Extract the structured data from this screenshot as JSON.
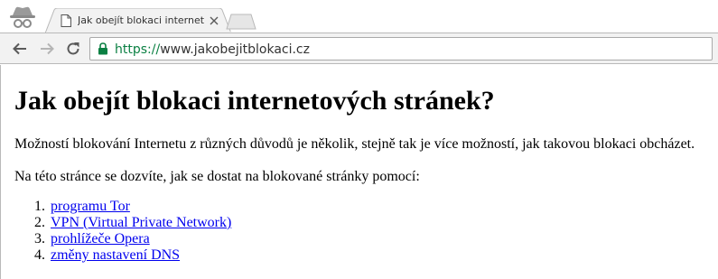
{
  "tab": {
    "title": "Jak obejít blokaci internetových stránek"
  },
  "address_bar": {
    "scheme": "https://",
    "host": "www.jakobejitblokaci.cz"
  },
  "icons": {
    "incognito": "incognito-icon",
    "favicon": "page-icon",
    "close": "close-icon",
    "back": "arrow-left-icon",
    "forward": "arrow-right-icon",
    "reload": "reload-icon",
    "lock": "lock-icon"
  },
  "colors": {
    "secure_green": "#0b8043",
    "link_blue": "#0000ee"
  },
  "page": {
    "heading": "Jak obejít blokaci internetových stránek?",
    "intro": "Možností blokování Internetu z různých důvodů je několik, stejně tak je více možností, jak takovou blokaci obcházet.",
    "lead": "Na této stránce se dozvíte, jak se dostat na blokované stránky pomocí:",
    "links": [
      {
        "number": "1.",
        "label": "programu Tor"
      },
      {
        "number": "2.",
        "label": "VPN (Virtual Private Network)"
      },
      {
        "number": "3.",
        "label": "prohlížeče Opera"
      },
      {
        "number": "4.",
        "label": "změny nastavení DNS"
      }
    ]
  }
}
